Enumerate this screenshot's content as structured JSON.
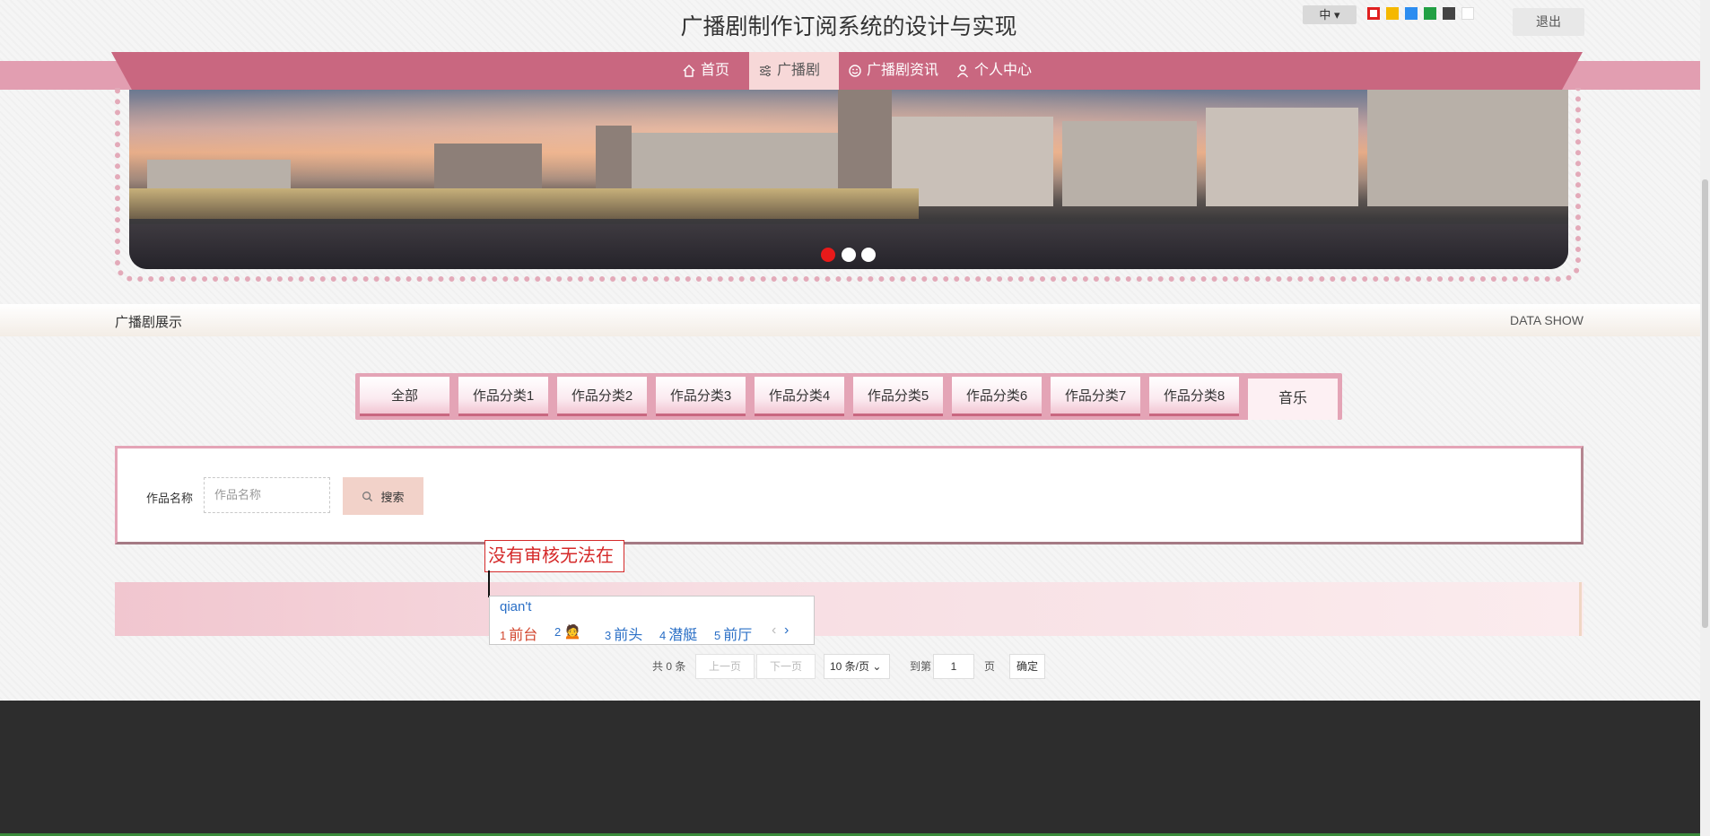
{
  "header": {
    "site_title": "广播剧制作订阅系统的设计与实现",
    "lang_label": "中 ▾",
    "theme_colors": [
      "#e02020",
      "#f5b800",
      "#2c8df0",
      "#22a044",
      "#444444",
      "#ffffff"
    ],
    "logout_label": "退出"
  },
  "nav": {
    "items": [
      {
        "label": "首页",
        "icon": "home-icon"
      },
      {
        "label": "广播剧",
        "icon": "sliders-icon"
      },
      {
        "label": "广播剧资讯",
        "icon": "smile-icon"
      },
      {
        "label": "个人中心",
        "icon": "user-icon"
      }
    ],
    "active_index": 1
  },
  "banner": {
    "dot_colors": [
      "#e81a1a",
      "#ffffff",
      "#ffffff"
    ]
  },
  "section": {
    "title": "广播剧展示",
    "subtitle_en": "DATA SHOW"
  },
  "tabs": [
    "全部",
    "作品分类1",
    "作品分类2",
    "作品分类3",
    "作品分类4",
    "作品分类5",
    "作品分类6",
    "作品分类7",
    "作品分类8",
    "音乐"
  ],
  "search": {
    "label": "作品名称",
    "placeholder": "作品名称",
    "button_label": "搜索"
  },
  "tooltip": {
    "text": "没有审核无法在"
  },
  "ime": {
    "input": "qian't",
    "candidates": [
      {
        "n": "1",
        "text": "前台"
      },
      {
        "n": "2",
        "text": "🙍"
      },
      {
        "n": "3",
        "text": "前头"
      },
      {
        "n": "4",
        "text": "潜艇"
      },
      {
        "n": "5",
        "text": "前厅"
      }
    ],
    "prev": "‹",
    "next": "›"
  },
  "pagination": {
    "total_text": "共 0 条",
    "prev_label": "上一页",
    "next_label": "下一页",
    "page_size": "10 条/页 ⌄",
    "goto_label": "到第",
    "page_value": "1",
    "page_unit": "页",
    "confirm_label": "确定"
  }
}
